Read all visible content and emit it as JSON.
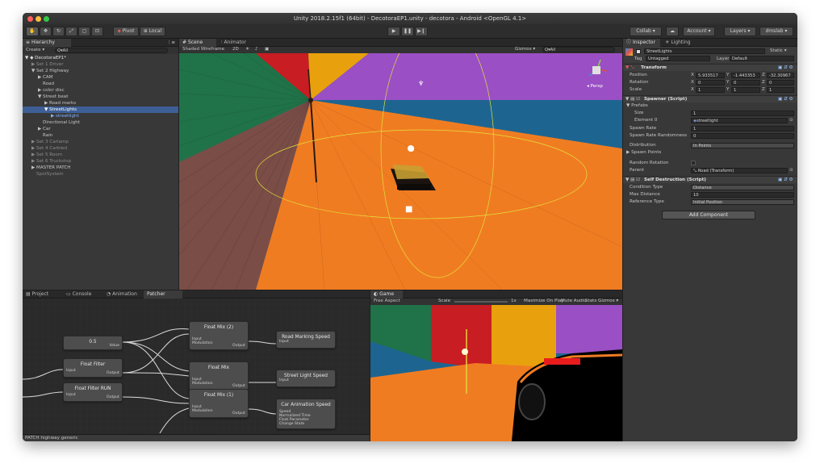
{
  "window": {
    "title": "Unity 2018.2.15f1 (64bit) - DecotoraEP1.unity - decotora - Android <OpenGL 4.1>"
  },
  "toolbar": {
    "pivot": "Pivot",
    "local": "Local",
    "collab": "Collab ▾",
    "account": "Account ▾",
    "layers": "Layers ▾",
    "layout": "dmslab ▾"
  },
  "hierarchy": {
    "tab": "Hierarchy",
    "create": "Create ▾",
    "search_placeholder": "Q▾All",
    "scene": "DecotoraEP1*",
    "items": [
      {
        "label": "Set 1 Driver",
        "indent": 1,
        "arrow": "▶",
        "dim": true
      },
      {
        "label": "Set 2 Highway",
        "indent": 1,
        "arrow": "▼",
        "dim": false
      },
      {
        "label": "CAM",
        "indent": 2,
        "arrow": "▶",
        "dim": false
      },
      {
        "label": "Road",
        "indent": 2,
        "arrow": "",
        "dim": false
      },
      {
        "label": "color disc",
        "indent": 2,
        "arrow": "▶",
        "dim": false
      },
      {
        "label": "Street beat",
        "indent": 2,
        "arrow": "▼",
        "dim": false
      },
      {
        "label": "Road marks",
        "indent": 3,
        "arrow": "▶",
        "dim": false
      },
      {
        "label": "StreetLights",
        "indent": 3,
        "arrow": "▼",
        "dim": false,
        "selected": true
      },
      {
        "label": "streetlight",
        "indent": 4,
        "arrow": "▶",
        "dim": false,
        "blue": true
      },
      {
        "label": "Directional Light",
        "indent": 2,
        "arrow": "",
        "dim": false
      },
      {
        "label": "Car",
        "indent": 2,
        "arrow": "▶",
        "dim": false
      },
      {
        "label": "Rain",
        "indent": 2,
        "arrow": "",
        "dim": false
      },
      {
        "label": "Set 3 Carlamp",
        "indent": 1,
        "arrow": "▶",
        "dim": true
      },
      {
        "label": "Set 4 Carbled",
        "indent": 1,
        "arrow": "▶",
        "dim": true
      },
      {
        "label": "Set 5 Room",
        "indent": 1,
        "arrow": "▶",
        "dim": true
      },
      {
        "label": "Set 6 Truckstop",
        "indent": 1,
        "arrow": "▶",
        "dim": true
      },
      {
        "label": "MASTER PATCH",
        "indent": 1,
        "arrow": "▶",
        "dim": false
      },
      {
        "label": "SpotSystem",
        "indent": 1,
        "arrow": "",
        "dim": true
      }
    ]
  },
  "scene": {
    "tab": "Scene",
    "tab2": "Animator",
    "shading": "Shaded Wireframe",
    "mode": "2D",
    "gizmos": "Gizmos ▾",
    "search": "Q▾All",
    "persp": "◂ Persp"
  },
  "bottom": {
    "tabs": [
      "Project",
      "Console",
      "Animation",
      "Patcher"
    ],
    "status": "PATCH highway generic"
  },
  "patcher": {
    "nodes": [
      {
        "id": "n05",
        "title": "0.5",
        "inputs": [],
        "outputs": [
          "Value"
        ]
      },
      {
        "id": "nff",
        "title": "Float Filter",
        "inputs": [
          "Input"
        ],
        "outputs": [
          "Output"
        ]
      },
      {
        "id": "nffr",
        "title": "Float Filter RUN",
        "inputs": [
          "Input"
        ],
        "outputs": [
          "Output"
        ]
      },
      {
        "id": "nfm2",
        "title": "Float Mix (2)",
        "inputs": [
          "Input",
          "Modulation"
        ],
        "outputs": [
          "Output"
        ]
      },
      {
        "id": "nfm",
        "title": "Float Mix",
        "inputs": [
          "Input",
          "Modulation"
        ],
        "outputs": [
          "Output"
        ]
      },
      {
        "id": "nfm1",
        "title": "Float Mix (1)",
        "inputs": [
          "Input",
          "Modulation"
        ],
        "outputs": [
          "Output"
        ]
      },
      {
        "id": "nrms",
        "title": "Road Marking Speed",
        "inputs": [
          "Input"
        ],
        "outputs": []
      },
      {
        "id": "nsls",
        "title": "Street Light Speed",
        "inputs": [
          "Input"
        ],
        "outputs": []
      },
      {
        "id": "ncas",
        "title": "Car Animation Speed",
        "inputs": [
          "Speed",
          "Normalized Time",
          "Float Parameter",
          "Change State"
        ],
        "outputs": []
      }
    ]
  },
  "game": {
    "tab": "Game",
    "aspect": "Free Aspect",
    "scale_label": "Scale",
    "scale_value": "1x",
    "maximize": "Maximize On Play",
    "mute": "Mute Audio",
    "stats": "Stats",
    "gizmos": "Gizmos ▾"
  },
  "inspector": {
    "tab": "Inspector",
    "tab2": "Lighting",
    "object_name": "StreetLights",
    "static": "Static ▾",
    "tag_label": "Tag",
    "tag_value": "Untagged",
    "layer_label": "Layer",
    "layer_value": "Default",
    "transform": {
      "title": "Transform",
      "position_label": "Position",
      "position": {
        "x": "5.933517",
        "y": "-1.443353",
        "z": "-32.30967"
      },
      "rotation_label": "Rotation",
      "rotation": {
        "x": "0",
        "y": "0",
        "z": "0"
      },
      "scale_label": "Scale",
      "scale": {
        "x": "1",
        "y": "1",
        "z": "1"
      }
    },
    "spawner": {
      "title": "Spawner (Script)",
      "prefabs_label": "Prefabs",
      "size_label": "Size",
      "size_value": "1",
      "element_label": "Element 0",
      "element_value": "streetlight",
      "spawn_rate_label": "Spawn Rate",
      "spawn_rate_value": "1",
      "randomness_label": "Spawn Rate Randomness",
      "randomness_value": "0",
      "distribution_label": "Distribution",
      "distribution_value": "In Points",
      "spawn_points_label": "Spawn Points",
      "random_rotation_label": "Random Rotation",
      "parent_label": "Parent",
      "parent_value": "Road (Transform)"
    },
    "self_destruction": {
      "title": "Self Destruction (Script)",
      "condition_label": "Condition Type",
      "condition_value": "Distance",
      "max_distance_label": "Max Distance",
      "max_distance_value": "10",
      "reference_label": "Reference Type",
      "reference_value": "Initial Position"
    },
    "add_component": "Add Component"
  }
}
